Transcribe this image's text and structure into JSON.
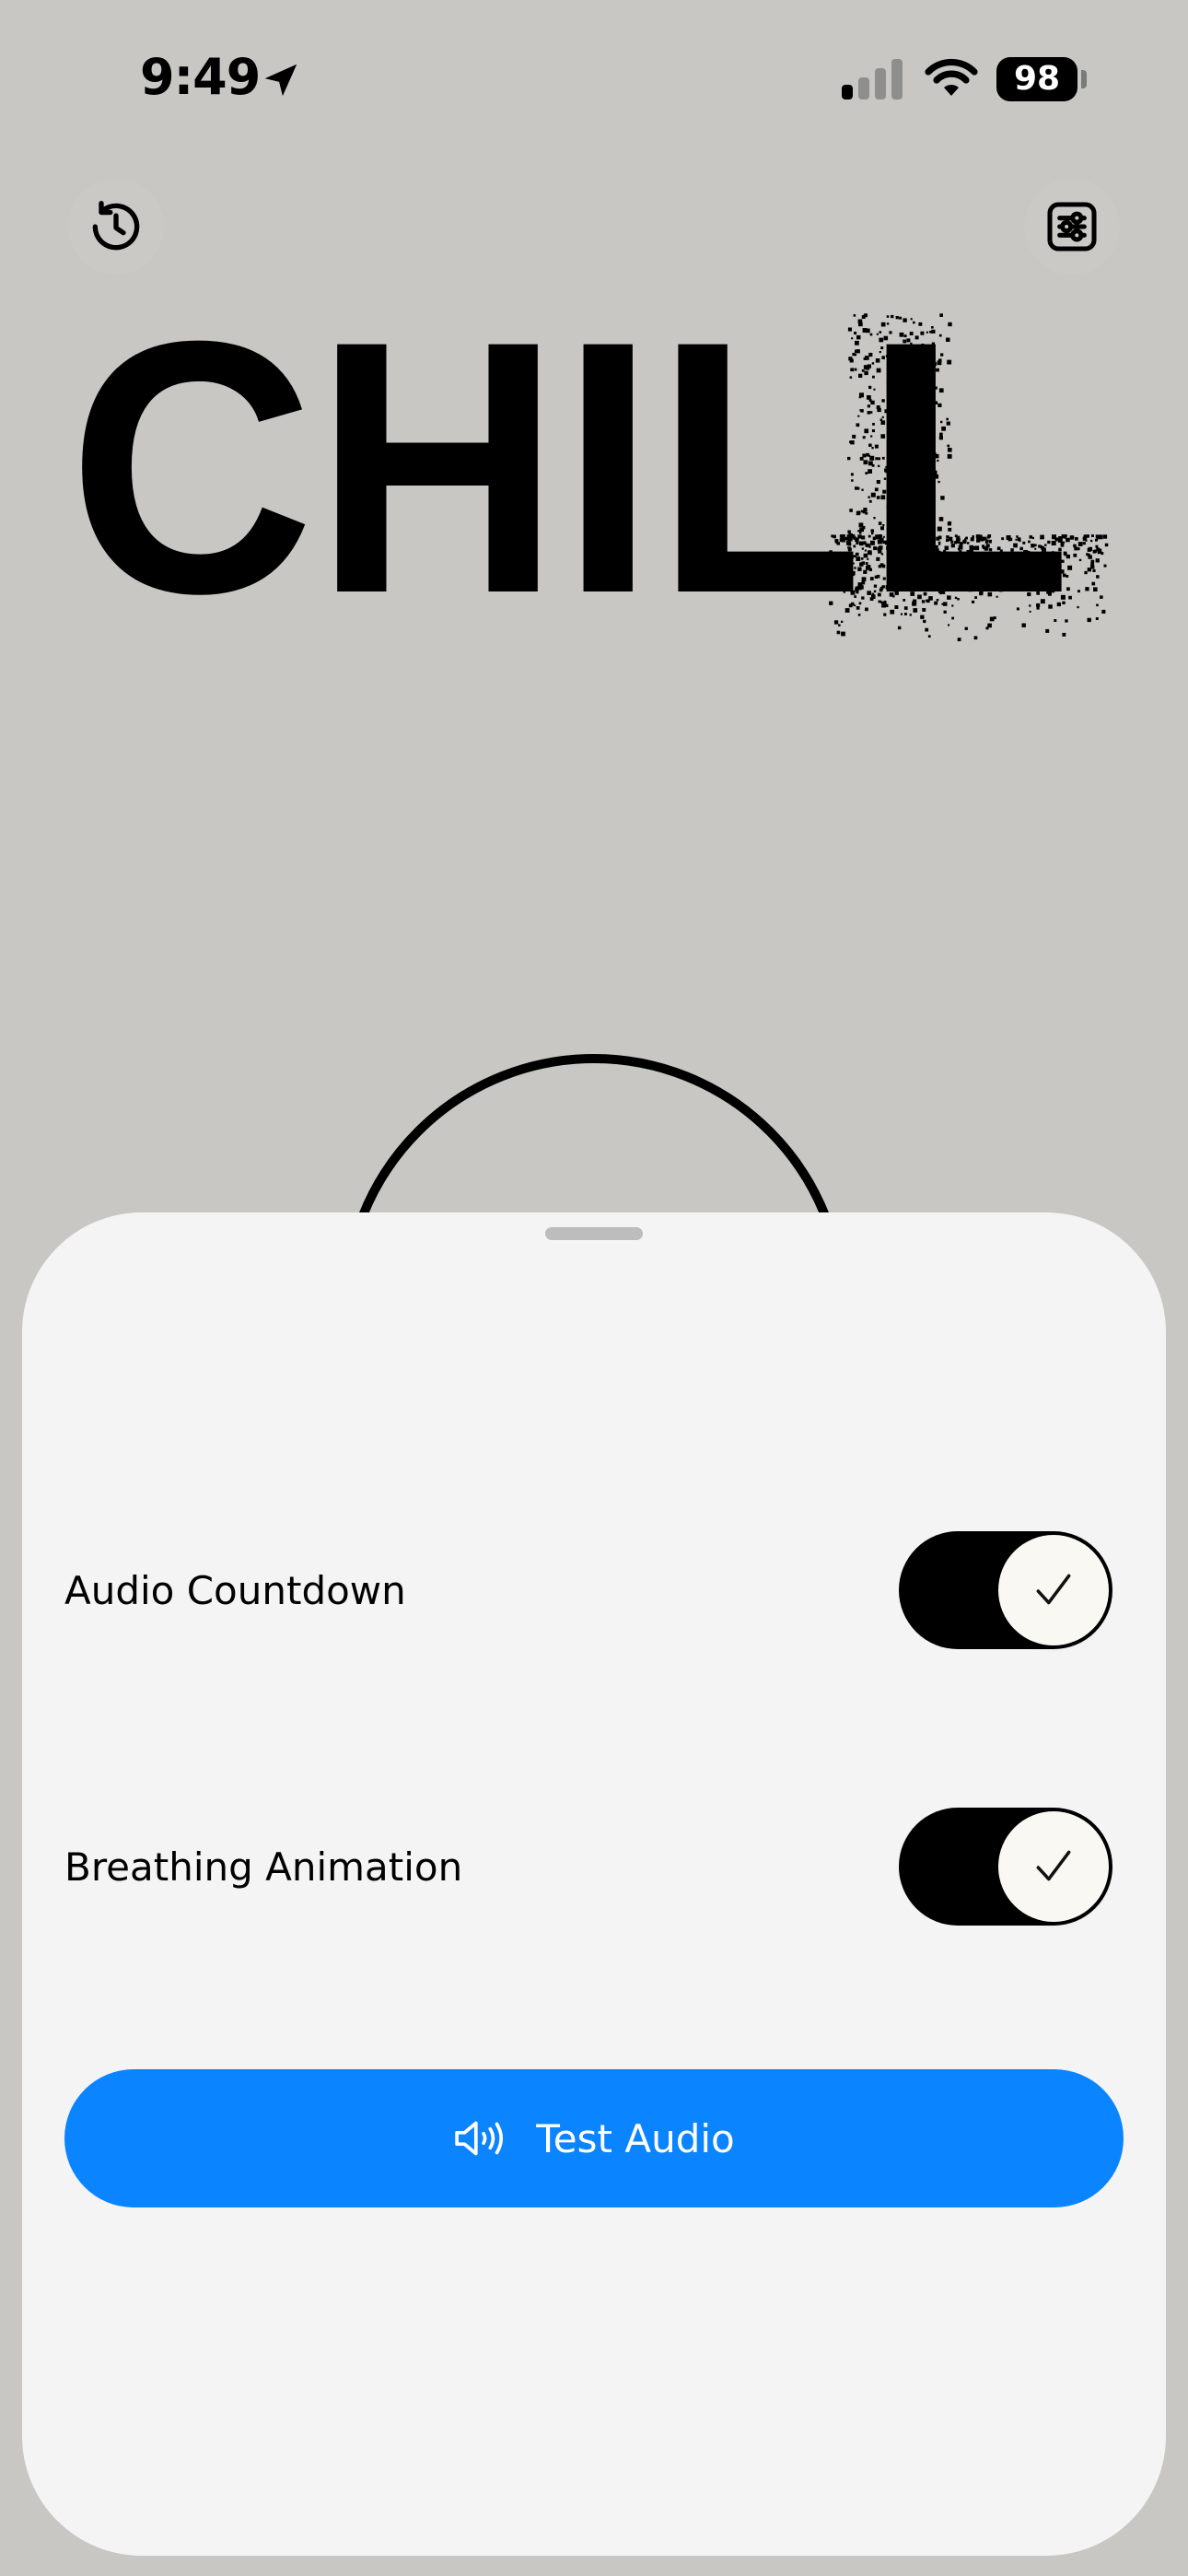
{
  "status_bar": {
    "time": "9:49",
    "battery": "98",
    "icons": [
      "location-arrow-icon",
      "cellular-signal-icon",
      "wifi-icon",
      "battery-icon"
    ]
  },
  "header": {
    "history_icon": "history-clock-icon",
    "settings_icon": "sliders-icon"
  },
  "logo": {
    "text": "CHILL"
  },
  "settings_sheet": {
    "rows": [
      {
        "label": "Audio Countdown",
        "enabled": true
      },
      {
        "label": "Breathing Animation",
        "enabled": true
      }
    ],
    "test_audio": {
      "label": "Test Audio",
      "icon": "speaker-wave-icon"
    }
  },
  "colors": {
    "background": "#c8c7c4",
    "sheet": "#f4f4f5",
    "toggle_on": "#000000",
    "accent_button": "#0a84ff"
  }
}
